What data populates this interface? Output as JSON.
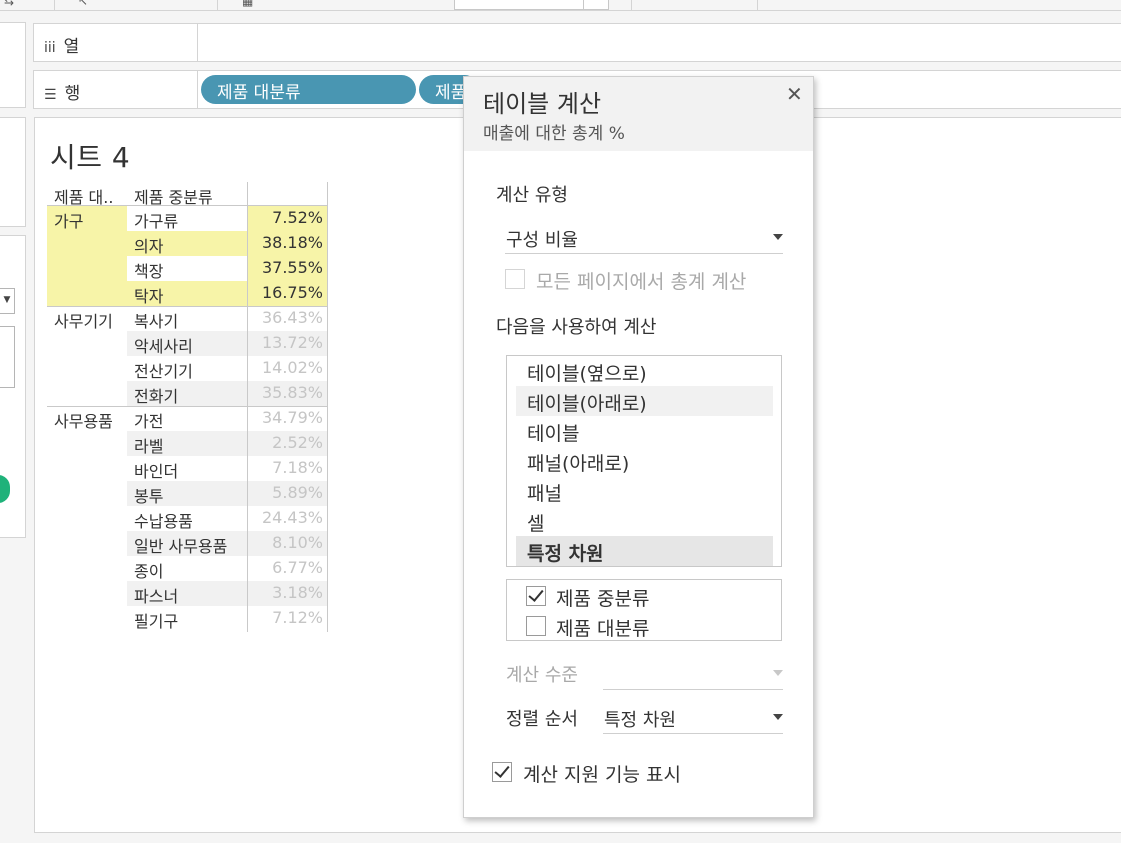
{
  "shelves": {
    "columns_label": "열",
    "rows_label": "행",
    "row_pills": [
      "제품 대분류",
      "제품"
    ]
  },
  "sheet": {
    "title": "시트 4",
    "headers": [
      "제품 대..",
      "제품 중분류"
    ],
    "groups": [
      {
        "name": "가구",
        "highlight": true,
        "rows": [
          {
            "sub": "가구류",
            "value": "7.52%"
          },
          {
            "sub": "의자",
            "value": "38.18%"
          },
          {
            "sub": "책장",
            "value": "37.55%"
          },
          {
            "sub": "탁자",
            "value": "16.75%"
          }
        ]
      },
      {
        "name": "사무기기",
        "highlight": false,
        "rows": [
          {
            "sub": "복사기",
            "value": "36.43%"
          },
          {
            "sub": "악세사리",
            "value": "13.72%"
          },
          {
            "sub": "전산기기",
            "value": "14.02%"
          },
          {
            "sub": "전화기",
            "value": "35.83%"
          }
        ]
      },
      {
        "name": "사무용품",
        "highlight": false,
        "rows": [
          {
            "sub": "가전",
            "value": "34.79%"
          },
          {
            "sub": "라벨",
            "value": "2.52%"
          },
          {
            "sub": "바인더",
            "value": "7.18%"
          },
          {
            "sub": "봉투",
            "value": "5.89%"
          },
          {
            "sub": "수납용품",
            "value": "24.43%"
          },
          {
            "sub": "일반 사무용품",
            "value": "8.10%"
          },
          {
            "sub": "종이",
            "value": "6.77%"
          },
          {
            "sub": "파스너",
            "value": "3.18%"
          },
          {
            "sub": "필기구",
            "value": "7.12%"
          }
        ]
      }
    ]
  },
  "dialog": {
    "title": "테이블 계산",
    "subtitle": "매출에 대한 총계 %",
    "calc_type_label": "계산 유형",
    "calc_type_value": "구성 비율",
    "all_pages_label": "모든 페이지에서 총계 계산",
    "compute_using_label": "다음을 사용하여 계산",
    "compute_options": [
      "테이블(옆으로)",
      "테이블(아래로)",
      "테이블",
      "패널(아래로)",
      "패널",
      "셀",
      "특정 차원"
    ],
    "hover_index": 1,
    "selected_index": 6,
    "dimensions": [
      {
        "label": "제품 중분류",
        "checked": true
      },
      {
        "label": "제품 대분류",
        "checked": false
      }
    ],
    "level_label": "계산 수준",
    "sort_label": "정렬 순서",
    "sort_value": "특정 차원",
    "show_assist_label": "계산 지원 기능 표시",
    "show_assist_checked": true
  },
  "colors": {
    "pill": "#4996b2",
    "highlight": "#f7f4a8",
    "accent_green": "#1fb27a"
  },
  "icons": {
    "columns_shelf": "columns-icon",
    "rows_shelf": "rows-icon",
    "close": "close-icon",
    "dropdown": "chevron-down-icon",
    "checkmark": "checkmark-icon"
  }
}
